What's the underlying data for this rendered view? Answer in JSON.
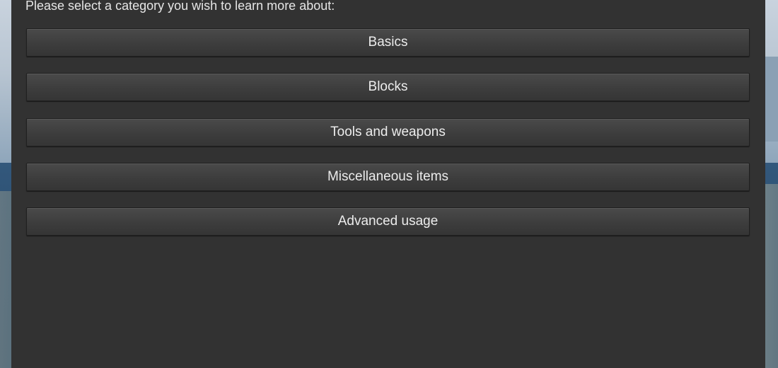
{
  "dialog": {
    "prompt": "Please select a category you wish to learn more about:",
    "buttons": [
      {
        "label": "Basics"
      },
      {
        "label": "Blocks"
      },
      {
        "label": "Tools and weapons"
      },
      {
        "label": "Miscellaneous items"
      },
      {
        "label": "Advanced usage"
      }
    ]
  }
}
